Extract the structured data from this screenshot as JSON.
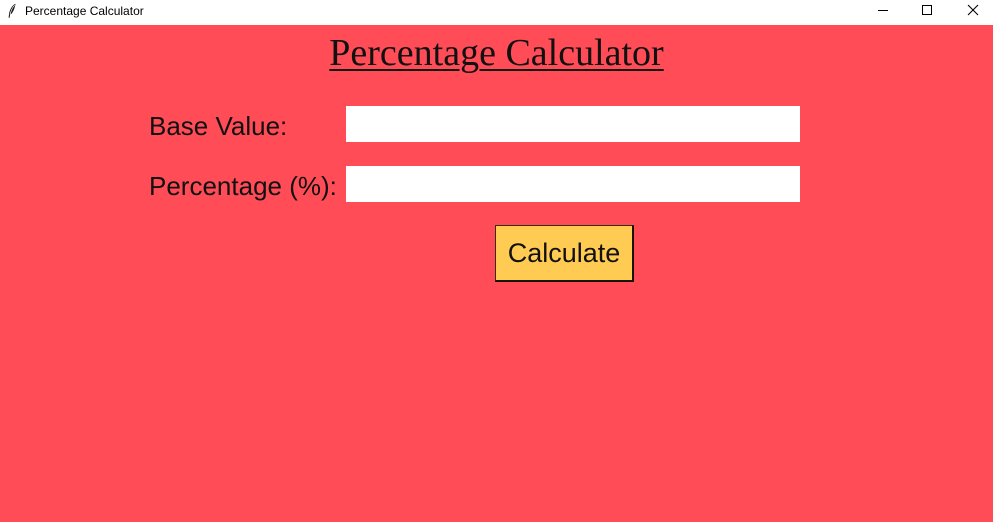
{
  "window": {
    "title": "Percentage Calculator",
    "icon": "feather-icon",
    "controls": [
      "minimize-icon",
      "maximize-icon",
      "close-icon"
    ]
  },
  "app": {
    "heading": "Percentage Calculator",
    "base_label": "Base Value:",
    "base_value": "",
    "percentage_label": "Percentage (%):",
    "percentage_value": "",
    "calculate_label": "Calculate"
  },
  "colors": {
    "background": "#ff4c56",
    "button": "#ffcb52",
    "entry": "#ffffff"
  }
}
